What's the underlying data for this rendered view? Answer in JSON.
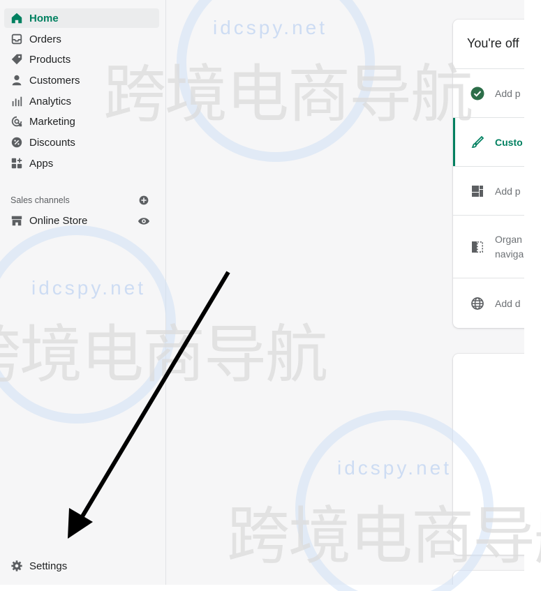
{
  "sidebar": {
    "items": [
      {
        "label": "Home",
        "icon": "home-icon",
        "active": true
      },
      {
        "label": "Orders",
        "icon": "inbox-icon"
      },
      {
        "label": "Products",
        "icon": "tag-icon"
      },
      {
        "label": "Customers",
        "icon": "person-icon"
      },
      {
        "label": "Analytics",
        "icon": "bar-chart-icon"
      },
      {
        "label": "Marketing",
        "icon": "target-icon"
      },
      {
        "label": "Discounts",
        "icon": "discount-icon"
      },
      {
        "label": "Apps",
        "icon": "apps-icon"
      }
    ],
    "sales_channels_label": "Sales channels",
    "online_store": {
      "label": "Online Store",
      "icon": "store-icon"
    },
    "settings": {
      "label": "Settings",
      "icon": "gear-icon"
    }
  },
  "main": {
    "setup_card": {
      "title": "You're off",
      "tasks": [
        {
          "label": "Add p",
          "icon": "check-circle-icon",
          "completed": true
        },
        {
          "label": "Custo",
          "icon": "brush-icon",
          "selected": true
        },
        {
          "label": "Add p",
          "icon": "page-layout-icon"
        },
        {
          "label": "Organ",
          "label_line2": "naviga",
          "icon": "navigation-icon"
        },
        {
          "label": "Add d",
          "icon": "globe-icon"
        }
      ]
    }
  },
  "watermark": {
    "text_latin": "idcspy.net",
    "text_cjk": "跨境电商导航"
  },
  "colors": {
    "accent": "#008060",
    "sidebar_bg": "#f6f6f7",
    "text": "#202223",
    "muted": "#6d7175",
    "icon": "#5c5f62"
  }
}
